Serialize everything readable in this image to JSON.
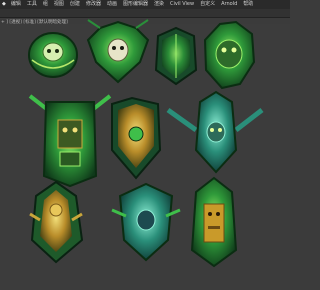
{
  "menubar": {
    "app_icon": "3dsmax-app-icon",
    "items": [
      "编辑",
      "工具",
      "组",
      "视图",
      "创建",
      "修改器",
      "动画",
      "图形编辑器",
      "渲染",
      "Civil View",
      "自定义",
      "Arnold",
      "帮助"
    ]
  },
  "viewport": {
    "label": "+ ] [透视] [标准] [默认明暗处理]"
  },
  "colors": {
    "background": "#3c3c3c",
    "accent_green": "#3fbf4a",
    "gold": "#c9a63a"
  },
  "assets": [
    {
      "name": "round-skull-shield"
    },
    {
      "name": "skull-crest-shield"
    },
    {
      "name": "armor-plate-shield"
    },
    {
      "name": "beast-face-shield"
    },
    {
      "name": "horned-totem-shield"
    },
    {
      "name": "gold-crest-shield"
    },
    {
      "name": "winged-skull-shield"
    },
    {
      "name": "golden-idol-shield"
    },
    {
      "name": "blue-green-crest-shield"
    },
    {
      "name": "tall-totem-shield"
    }
  ]
}
